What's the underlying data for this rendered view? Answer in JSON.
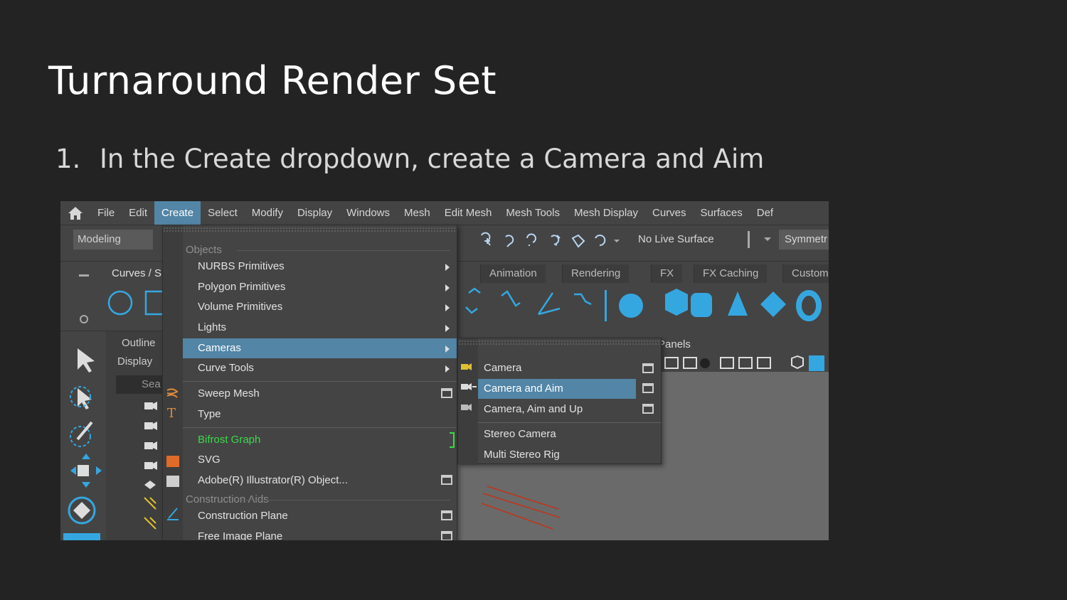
{
  "slide": {
    "title": "Turnaround Render Set",
    "step_number": "1.",
    "step_text": "In the Create dropdown, create a Camera and Aim"
  },
  "menubar": {
    "items": [
      "File",
      "Edit",
      "Create",
      "Select",
      "Modify",
      "Display",
      "Windows",
      "Mesh",
      "Edit Mesh",
      "Mesh Tools",
      "Mesh Display",
      "Curves",
      "Surfaces",
      "Def"
    ],
    "active": "Create"
  },
  "status_line": {
    "mode": "Modeling",
    "live_surface": "No Live Surface",
    "symmetry": "Symmetr"
  },
  "shelf": {
    "current_tab": "Curves / S",
    "tabs": [
      "Animation",
      "Rendering",
      "FX",
      "FX Caching",
      "Custom"
    ]
  },
  "outliner": {
    "title": "Outline",
    "display": "Display",
    "search": "Sea"
  },
  "panels_label": "Panels",
  "create_menu": {
    "section_objects": "Objects",
    "items": [
      {
        "label": "NURBS Primitives"
      },
      {
        "label": "Polygon Primitives"
      },
      {
        "label": "Volume Primitives"
      },
      {
        "label": "Lights"
      },
      {
        "label": "Cameras"
      },
      {
        "label": "Curve Tools"
      },
      {
        "label": "Sweep Mesh"
      },
      {
        "label": "Type"
      },
      {
        "label": "Bifrost Graph"
      },
      {
        "label": "SVG"
      },
      {
        "label": "Adobe(R) Illustrator(R) Object..."
      }
    ],
    "section_construction": "Construction Aids",
    "construction_items": [
      {
        "label": "Construction Plane"
      },
      {
        "label": "Free Image Plane"
      }
    ]
  },
  "cameras_submenu": {
    "items": [
      {
        "label": "Camera"
      },
      {
        "label": "Camera and Aim"
      },
      {
        "label": "Camera, Aim and Up"
      },
      {
        "label": "Stereo Camera"
      },
      {
        "label": "Multi Stereo Rig"
      }
    ],
    "active": "Camera and Aim"
  },
  "colors": {
    "background": "#232323",
    "highlight": "#5285a6",
    "bifrost_green": "#3bd94a",
    "shelf_blue": "#35a7e0"
  }
}
